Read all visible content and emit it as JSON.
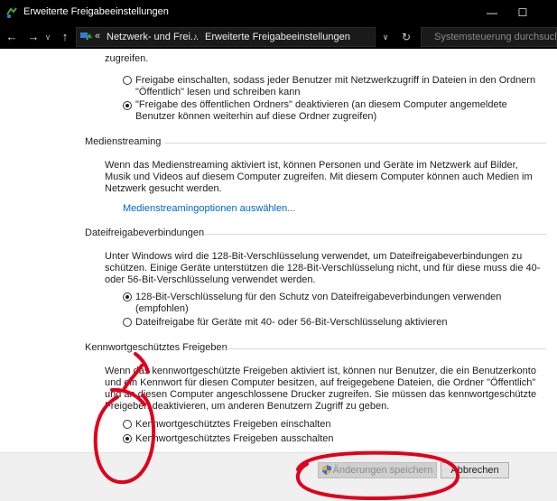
{
  "window": {
    "title": "Erweiterte Freigabeeinstellungen",
    "minimize_glyph": "—",
    "maximize_glyph": "☐"
  },
  "address": {
    "back_glyph": "←",
    "forward_glyph": "→",
    "up_glyph": "↑",
    "overflow_glyph": "«",
    "crumbs": [
      "Netzwerk- und Frei...",
      "Erweiterte Freigabeeinstellungen"
    ],
    "crumb_sep": "›",
    "dropdown_glyph": "∨",
    "refresh_glyph": "↻",
    "search_placeholder": "Systemsteuerung durchsuchen"
  },
  "public_folder": {
    "intro_text": "zugreifen.",
    "options": [
      {
        "line1": "Freigabe einschalten, sodass jeder Benutzer mit Netzwerkzugriff in Dateien in den Ordnern",
        "line2": "\"Öffentlich\" lesen und schreiben kann",
        "checked": false
      },
      {
        "line1": "\"Freigabe des öffentlichen Ordners\" deaktivieren (an diesem Computer angemeldete",
        "line2": "Benutzer können weiterhin auf diese Ordner zugreifen)",
        "checked": true
      }
    ]
  },
  "media_streaming": {
    "title": "Medienstreaming",
    "description": [
      "Wenn das Medienstreaming aktiviert ist, können Personen und Geräte im Netzwerk auf Bilder,",
      "Musik und Videos auf diesem Computer zugreifen. Mit diesem Computer können auch Medien im",
      "Netzwerk gesucht werden."
    ],
    "link": "Medienstreamingoptionen auswählen..."
  },
  "file_sharing": {
    "title": "Dateifreigabeverbindungen",
    "description": [
      "Unter Windows wird die 128-Bit-Verschlüsselung verwendet, um Dateifreigabeverbindungen zu",
      "schützen. Einige Geräte unterstützen die 128-Bit-Verschlüsselung nicht, und für diese muss die 40-",
      "oder 56-Bit-Verschlüsselung verwendet werden."
    ],
    "options": [
      {
        "line1": "128-Bit-Verschlüsselung für den Schutz von Dateifreigabeverbindungen verwenden",
        "line2": "(empfohlen)",
        "checked": true
      },
      {
        "line1": "Dateifreigabe für Geräte mit 40- oder 56-Bit-Verschlüsselung aktivieren",
        "line2": "",
        "checked": false
      }
    ]
  },
  "password_sharing": {
    "title": "Kennwortgeschütztes Freigeben",
    "description": [
      "Wenn das kennwortgeschützte Freigeben aktiviert ist, können nur Benutzer, die ein Benutzerkonto",
      "und ein Kennwort für diesen Computer besitzen, auf freigegebene Dateien, die Ordner \"Öffentlich\"",
      "und an diesen Computer angeschlossene Drucker zugreifen. Sie müssen das kennwortgeschützte",
      "Freigeben deaktivieren, um anderen Benutzern Zugriff zu geben."
    ],
    "options": [
      {
        "line1": "Kennwortgeschütztes Freigeben einschalten",
        "checked": false
      },
      {
        "line1": "Kennwortgeschütztes Freigeben ausschalten",
        "checked": true
      }
    ]
  },
  "footer": {
    "save_label": "Änderungen speichern",
    "cancel_label": "Abbrechen"
  },
  "colors": {
    "titlebar": "#000000",
    "link": "#0066cc",
    "annotation": "#e0001b"
  }
}
